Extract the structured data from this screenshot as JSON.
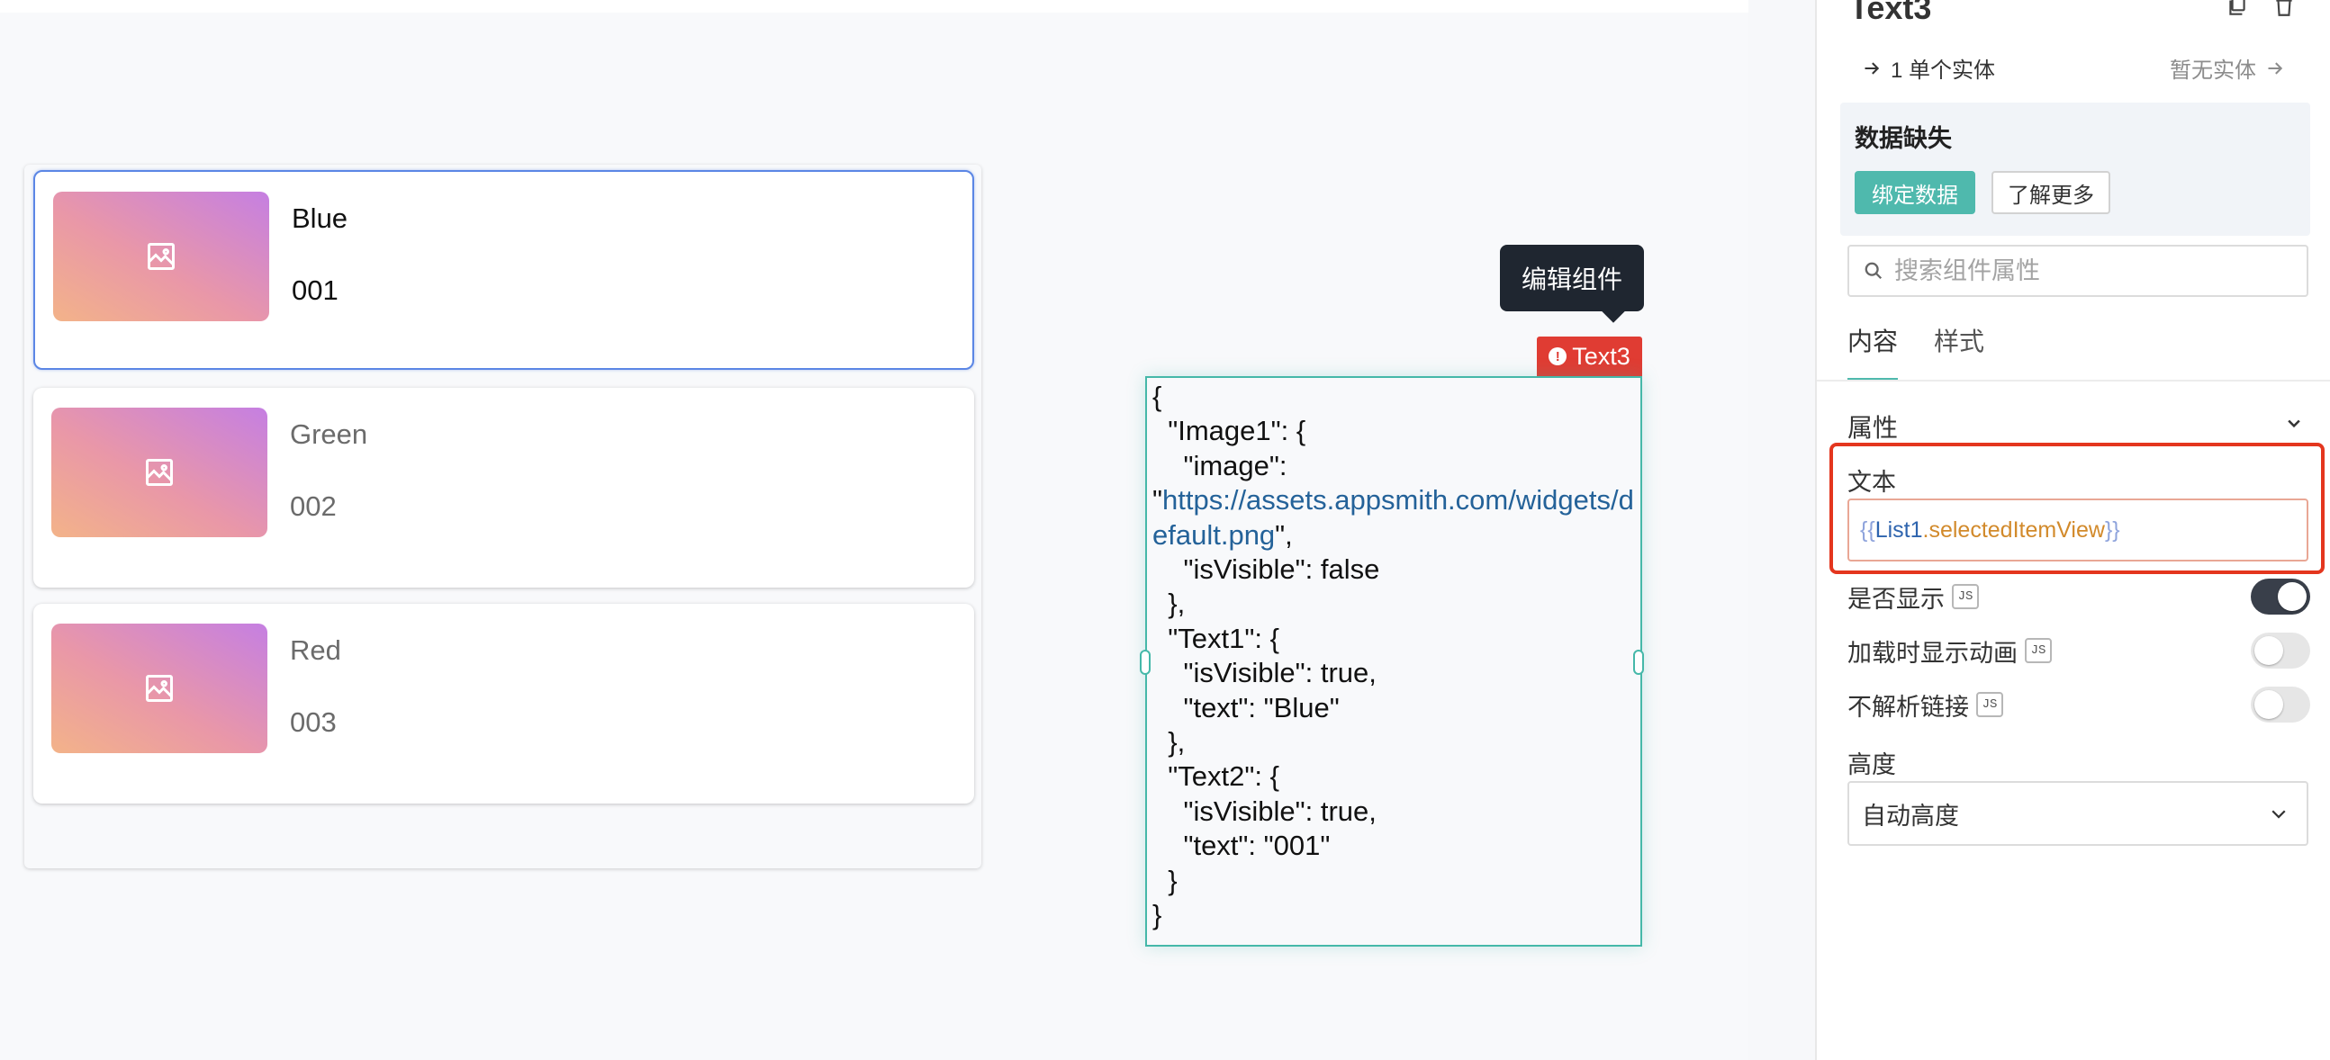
{
  "list": {
    "items": [
      {
        "title": "Blue",
        "code": "001"
      },
      {
        "title": "Green",
        "code": "002"
      },
      {
        "title": "Red",
        "code": "003"
      }
    ]
  },
  "text_widget": {
    "tooltip": "编辑组件",
    "name": "Text3",
    "content": {
      "line1": "{",
      "line2": "  \"Image1\": {",
      "line3": "    \"image\":",
      "quote_open": "\"",
      "link": "https://assets.appsmith.com/widgets/default.png",
      "quote_close": "\",",
      "line5": "    \"isVisible\": false",
      "line6": "  },",
      "line7": "  \"Text1\": {",
      "line8": "    \"isVisible\": true,",
      "line9": "    \"text\": \"Blue\"",
      "line10": "  },",
      "line11": "  \"Text2\": {",
      "line12": "    \"isVisible\": true,",
      "line13": "    \"text\": \"001\"",
      "line14": "  }",
      "line15": "}"
    }
  },
  "panel": {
    "title": "Text3",
    "entities_left": "1 单个实体",
    "entities_right": "暂无实体",
    "missing": {
      "title": "数据缺失",
      "bind_label": "绑定数据",
      "learn_label": "了解更多"
    },
    "search_placeholder": "搜索组件属性",
    "tabs": [
      {
        "label": "内容",
        "active": true
      },
      {
        "label": "样式",
        "active": false
      }
    ],
    "section": "属性",
    "text_field": {
      "label": "文本",
      "brace_open": "{{",
      "object": "List1",
      "property": ".selectedItemView",
      "brace_close": "}}"
    },
    "js_badge": "JS",
    "props": [
      {
        "label": "是否显示",
        "on": true
      },
      {
        "label": "加载时显示动画",
        "on": false
      },
      {
        "label": "不解析链接",
        "on": false
      }
    ],
    "height": {
      "label": "高度",
      "value": "自动高度"
    }
  },
  "colors": {
    "accent": "#4fb9ad",
    "error": "#e03c33",
    "selection": "#5b86e5"
  }
}
